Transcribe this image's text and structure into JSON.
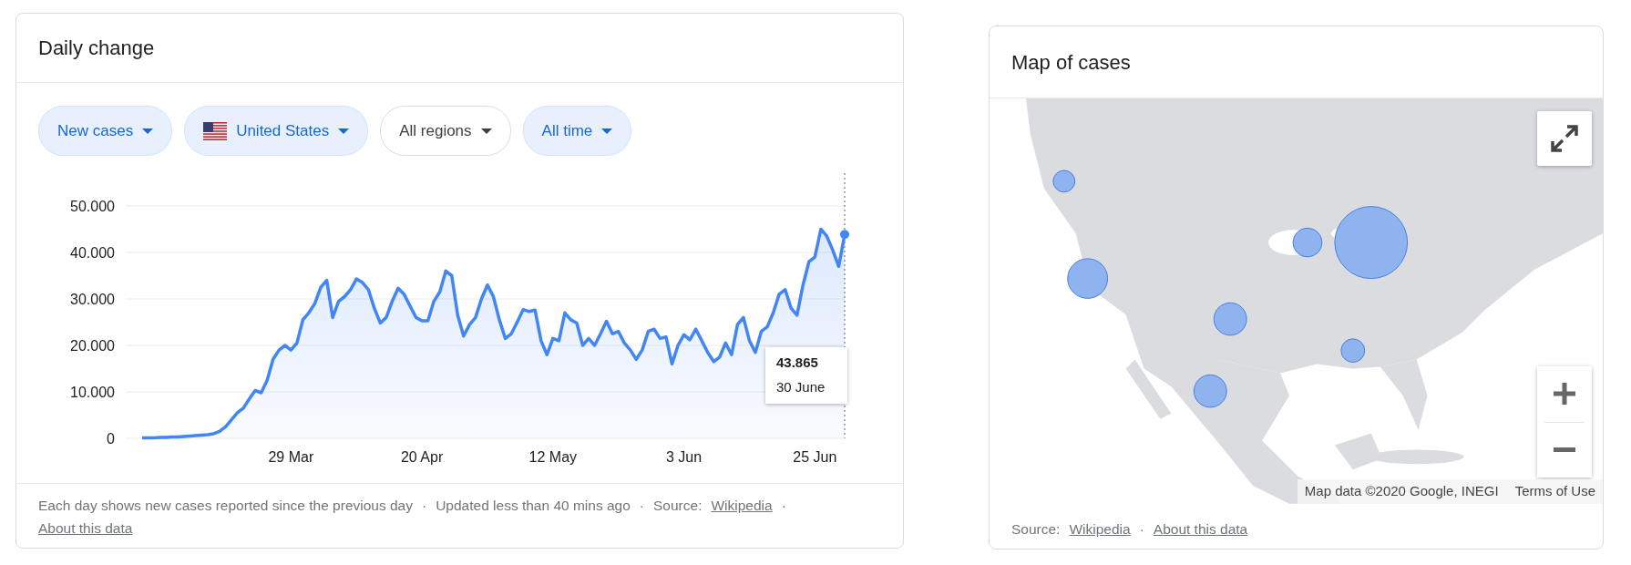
{
  "daily_change": {
    "title": "Daily change",
    "filters": [
      {
        "label": "New cases",
        "kind": "plain",
        "selected": true
      },
      {
        "label": "United States",
        "kind": "flag",
        "selected": true
      },
      {
        "label": "All regions",
        "kind": "plain",
        "selected": false
      },
      {
        "label": "All time",
        "kind": "plain",
        "selected": true
      }
    ],
    "chart_data": {
      "type": "area",
      "grid": true,
      "ylim": [
        0,
        50000
      ],
      "categories": [
        null,
        null,
        null,
        null,
        null,
        null,
        null,
        null,
        null,
        null,
        null,
        null,
        null,
        null,
        null,
        null,
        null,
        null,
        null,
        null,
        null,
        null,
        null,
        null,
        null,
        "29 Mar",
        null,
        null,
        null,
        null,
        null,
        null,
        null,
        null,
        null,
        null,
        null,
        null,
        null,
        null,
        null,
        null,
        null,
        null,
        null,
        null,
        null,
        "20 Apr",
        null,
        null,
        null,
        null,
        null,
        null,
        null,
        null,
        null,
        null,
        null,
        null,
        null,
        null,
        null,
        null,
        null,
        null,
        null,
        null,
        null,
        "12 May",
        null,
        null,
        null,
        null,
        null,
        null,
        null,
        null,
        null,
        null,
        null,
        null,
        null,
        null,
        null,
        null,
        null,
        null,
        null,
        null,
        null,
        "3 Jun",
        null,
        null,
        null,
        null,
        null,
        null,
        null,
        null,
        null,
        null,
        null,
        null,
        null,
        null,
        null,
        null,
        null,
        null,
        null,
        null,
        null,
        "25 Jun",
        null,
        null,
        null,
        null,
        null
      ],
      "yticks": [
        {
          "value": 0,
          "label": "0"
        },
        {
          "value": 10000,
          "label": "10.000"
        },
        {
          "value": 20000,
          "label": "20.000"
        },
        {
          "value": 30000,
          "label": "30.000"
        },
        {
          "value": 40000,
          "label": "40.000"
        },
        {
          "value": 50000,
          "label": "50.000"
        }
      ],
      "series": [
        {
          "color": "#4285f4",
          "values": [
            100,
            100,
            100,
            200,
            200,
            300,
            300,
            400,
            500,
            600,
            700,
            800,
            1000,
            1500,
            2500,
            4000,
            5500,
            6500,
            8500,
            10300,
            9800,
            12500,
            17000,
            19000,
            20000,
            19000,
            20500,
            25500,
            27000,
            29000,
            32500,
            34000,
            26000,
            29500,
            30500,
            32000,
            34300,
            33500,
            32000,
            28000,
            24800,
            26000,
            29500,
            32300,
            31000,
            28500,
            26000,
            25300,
            25300,
            29500,
            31500,
            36000,
            35000,
            26500,
            22000,
            24500,
            26000,
            30000,
            33000,
            30500,
            25500,
            21500,
            22500,
            25000,
            27700,
            27300,
            27600,
            21000,
            18000,
            21500,
            21000,
            27000,
            25500,
            24800,
            20000,
            21500,
            20000,
            22500,
            25200,
            22500,
            23000,
            20500,
            19000,
            17000,
            19000,
            23000,
            23500,
            21500,
            21800,
            16000,
            20000,
            22300,
            21200,
            23500,
            21000,
            18500,
            16500,
            17500,
            20500,
            18000,
            24500,
            26000,
            21000,
            18500,
            23000,
            24000,
            27000,
            31000,
            32000,
            28000,
            26500,
            33000,
            38000,
            39000,
            45000,
            43500,
            40500,
            37000,
            43865
          ]
        }
      ]
    },
    "tooltip": {
      "value": "43.865",
      "date": "30 June"
    },
    "footer": [
      {
        "kind": "text",
        "text": "Each day shows new cases reported since the previous day"
      },
      {
        "kind": "sep",
        "text": "·"
      },
      {
        "kind": "text",
        "text": "Updated less than 40 mins ago"
      },
      {
        "kind": "sep",
        "text": "·"
      },
      {
        "kind": "text",
        "text": "Source:"
      },
      {
        "kind": "link",
        "text": "Wikipedia"
      },
      {
        "kind": "sep",
        "text": "·"
      },
      {
        "kind": "link",
        "text": "About this data"
      }
    ]
  },
  "map_of_cases": {
    "title": "Map of cases",
    "attribution": "Map data ©2020 Google, INEGI",
    "terms": "Terms of Use",
    "footer": [
      {
        "kind": "text",
        "text": "Source:"
      },
      {
        "kind": "link",
        "text": "Wikipedia"
      },
      {
        "kind": "sep",
        "text": "·"
      },
      {
        "kind": "link",
        "text": "About this data"
      }
    ]
  }
}
